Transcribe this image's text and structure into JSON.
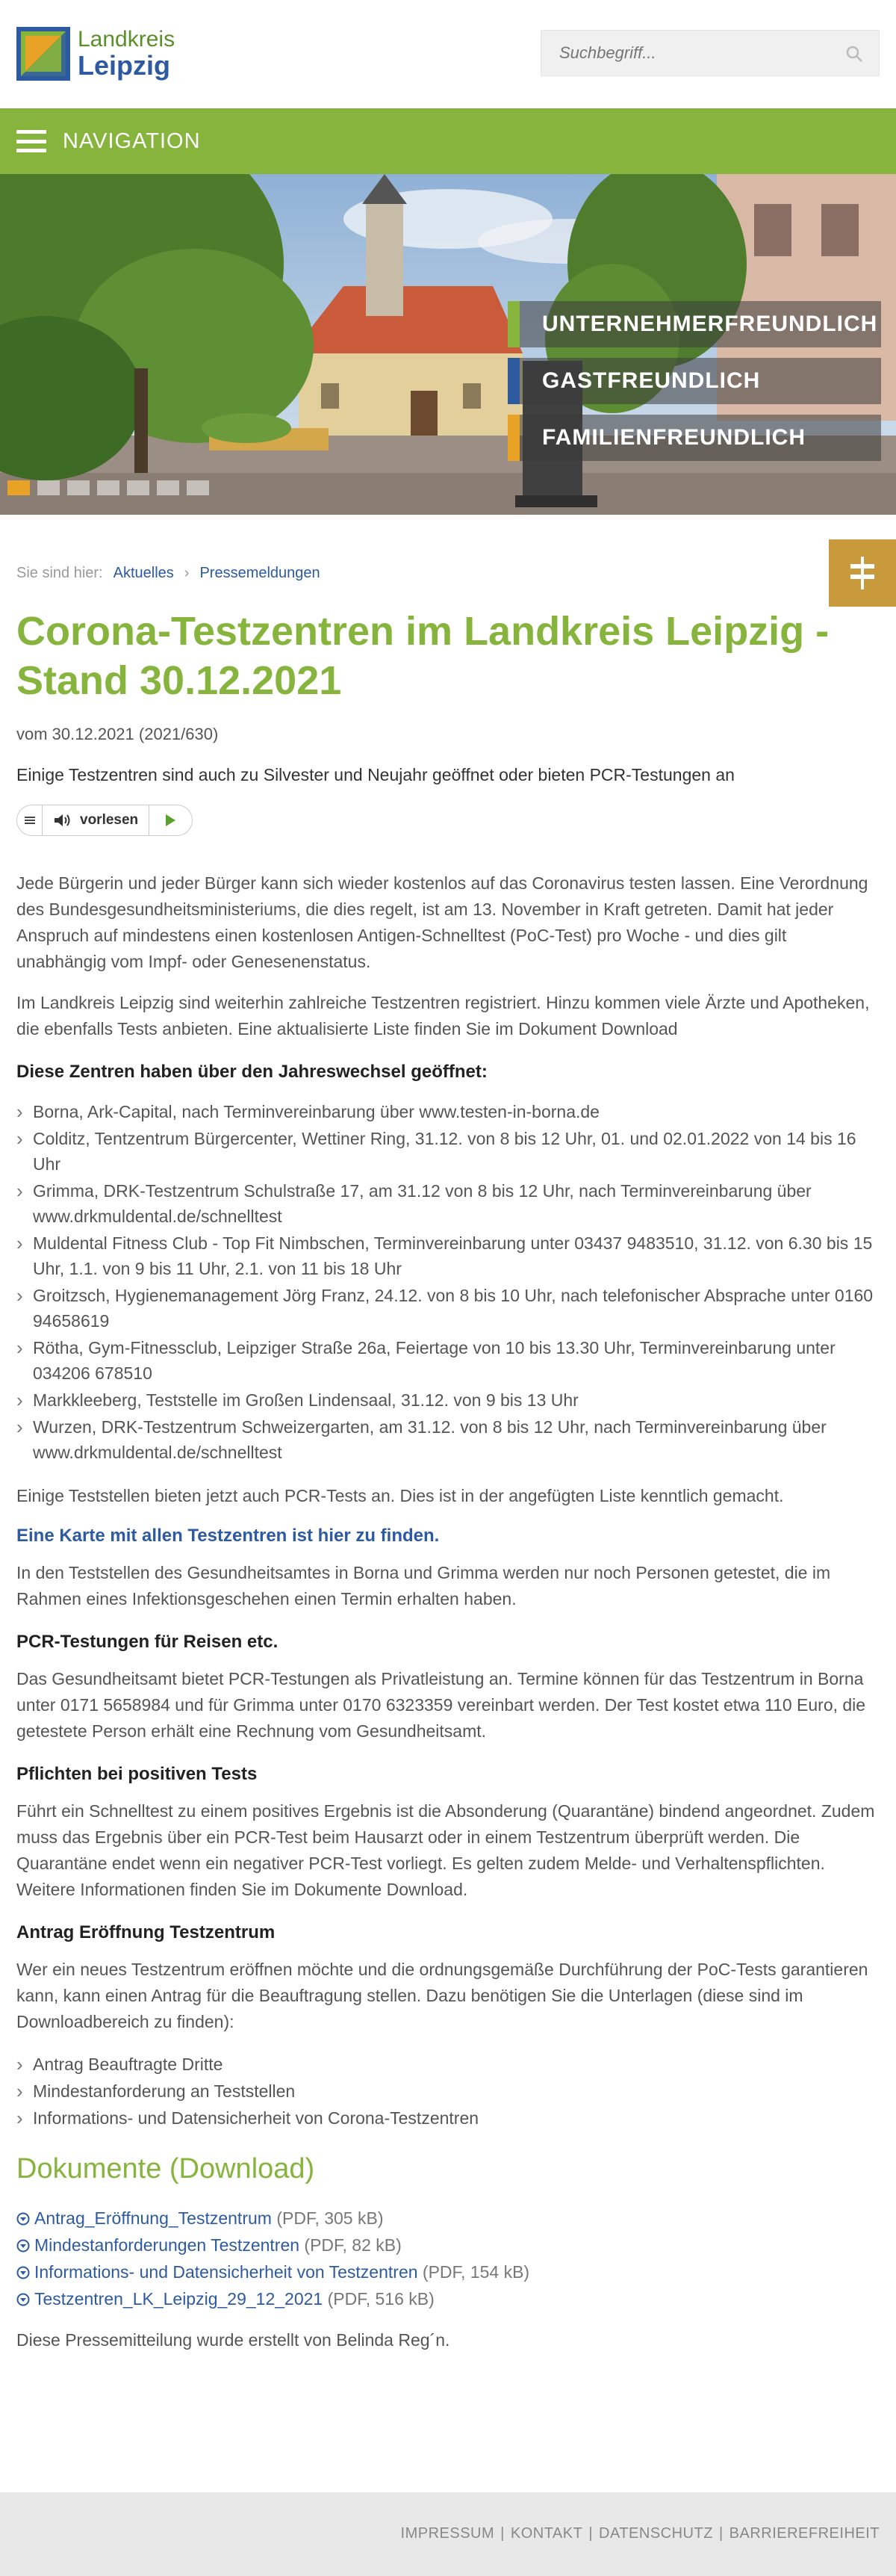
{
  "header": {
    "logo_line1": "Landkreis",
    "logo_line2": "Leipzig",
    "search_placeholder": "Suchbegriff..."
  },
  "nav": {
    "label": "NAVIGATION"
  },
  "hero": {
    "slogans": [
      {
        "text": "UNTERNEHMERFREUNDLICH",
        "color": "#86b43c"
      },
      {
        "text": "GASTFREUNDLICH",
        "color": "#2d5aa0"
      },
      {
        "text": "FAMILIENFREUNDLICH",
        "color": "#e8a327"
      }
    ],
    "slide_count": 7,
    "active_slide": 1
  },
  "breadcrumb": {
    "prefix": "Sie sind hier:",
    "items": [
      "Aktuelles",
      "Pressemeldungen"
    ],
    "separator": "›"
  },
  "article": {
    "title": "Corona-Testzentren im Landkreis Leipzig - Stand 30.12.2021",
    "date": "vom 30.12.2021 (2021/630)",
    "lead": "Einige Testzentren sind auch zu Silvester und Neujahr geöffnet oder bieten PCR-Testungen an",
    "readspeaker_label": "vorlesen",
    "p1": "Jede Bürgerin und jeder Bürger kann sich wieder kostenlos auf das Coronavirus testen lassen. Eine Verordnung des Bundesgesundheitsministeriums, die dies regelt, ist am 13. November in Kraft getreten. Damit hat jeder Anspruch auf mindestens einen kostenlosen Antigen-Schnelltest (PoC-Test) pro Woche - und dies gilt unabhängig vom Impf- oder Genesenenstatus.",
    "p2": "Im Landkreis Leipzig sind weiterhin zahlreiche Testzentren registriert. Hinzu kommen viele Ärzte und Apotheken, die ebenfalls Tests anbieten. Eine aktualisierte Liste finden Sie im Dokument Download",
    "h_open": "Diese Zentren haben über den Jahreswechsel geöffnet:",
    "centers": [
      "Borna, Ark-Capital, nach Terminvereinbarung über www.testen-in-borna.de",
      "Colditz, Tentzentrum Bürgercenter, Wettiner Ring, 31.12. von 8 bis 12 Uhr, 01. und 02.01.2022 von 14 bis 16 Uhr",
      "Grimma, DRK-Testzentrum Schulstraße 17, am 31.12 von 8 bis 12 Uhr, nach Terminvereinbarung über www.drkmuldental.de/schnelltest",
      "Muldental Fitness Club - Top Fit Nimbschen, Terminvereinbarung unter 03437 9483510, 31.12. von 6.30 bis 15 Uhr, 1.1. von 9 bis 11 Uhr, 2.1. von 11 bis 18 Uhr",
      "Groitzsch, Hygienemanagement Jörg Franz, 24.12. von 8 bis 10 Uhr, nach telefonischer Absprache unter 0160 94658619",
      "Rötha, Gym-Fitnessclub, Leipziger Straße 26a, Feiertage von 10 bis 13.30 Uhr, Terminvereinbarung unter 034206 678510",
      "Markkleeberg, Teststelle im Großen Lindensaal, 31.12. von 9 bis 13 Uhr",
      "Wurzen, DRK-Testzentrum Schweizergarten, am 31.12. von 8 bis 12 Uhr, nach Terminvereinbarung über www.drkmuldental.de/schnelltest"
    ],
    "p3": "Einige Teststellen bieten jetzt auch PCR-Tests an. Dies ist in der angefügten Liste kenntlich gemacht.",
    "map_link": "Eine Karte mit allen Testzentren ist hier zu finden.",
    "p4": "In den Teststellen des Gesundheitsamtes in Borna und Grimma werden nur noch Personen getestet, die im Rahmen eines Infektionsgeschehen einen Termin erhalten haben.",
    "h_pcr": "PCR-Testungen für Reisen etc.",
    "p5": "Das Gesundheitsamt bietet PCR-Testungen als Privatleistung an. Termine können für das Testzentrum in Borna unter 0171 5658984 und für Grimma unter 0170 6323359 vereinbart werden. Der Test kostet etwa 110 Euro, die getestete Person erhält eine Rechnung vom Gesundheitsamt.",
    "h_pflichten": "Pflichten bei positiven Tests",
    "p6": "Führt ein Schnelltest zu einem positives Ergebnis ist die Absonderung (Quarantäne) bindend angeordnet. Zudem muss das Ergebnis über ein PCR-Test beim Hausarzt oder in einem Testzentrum überprüft werden. Die Quarantäne endet wenn ein negativer PCR-Test vorliegt. Es gelten zudem Melde- und Verhaltenspflichten. Weitere Informationen finden Sie im Dokumente Download.",
    "h_antrag": "Antrag Eröffnung Testzentrum",
    "p7": "Wer ein neues Testzentrum eröffnen möchte und die ordnungsgemäße Durchführung der PoC-Tests garantieren kann, kann einen Antrag für die Beauftragung stellen. Dazu benötigen Sie die Unterlagen (diese sind im Downloadbereich zu finden):",
    "antrag_items": [
      "Antrag Beauftragte Dritte",
      "Mindestanforderung an Teststellen",
      "Informations- und Datensicherheit von Corona-Testzentren"
    ],
    "h_docs": "Dokumente (Download)",
    "documents": [
      {
        "name": "Antrag_Eröffnung_Testzentrum",
        "meta": "(PDF, 305 kB)"
      },
      {
        "name": "Mindestanforderungen Testzentren",
        "meta": "(PDF, 82 kB)"
      },
      {
        "name": "Informations- und Datensicherheit von Testzentren",
        "meta": "(PDF, 154 kB)"
      },
      {
        "name": "Testzentren_LK_Leipzig_29_12_2021",
        "meta": "(PDF, 516 kB)"
      }
    ],
    "author": "Diese Pressemitteilung wurde erstellt von Belinda Reg´n."
  },
  "footer": {
    "links": [
      "IMPRESSUM",
      "KONTAKT",
      "DATENSCHUTZ",
      "BARRIEREFREIHEIT"
    ]
  },
  "colors": {
    "green": "#86b43c",
    "blue": "#2d5aa0",
    "orange": "#e8a327",
    "sign": "#c99a3c"
  },
  "icons": [
    "logo-mark-icon",
    "search-icon",
    "hamburger-icon",
    "signpost-icon",
    "speaker-icon",
    "play-icon",
    "download-icon"
  ]
}
